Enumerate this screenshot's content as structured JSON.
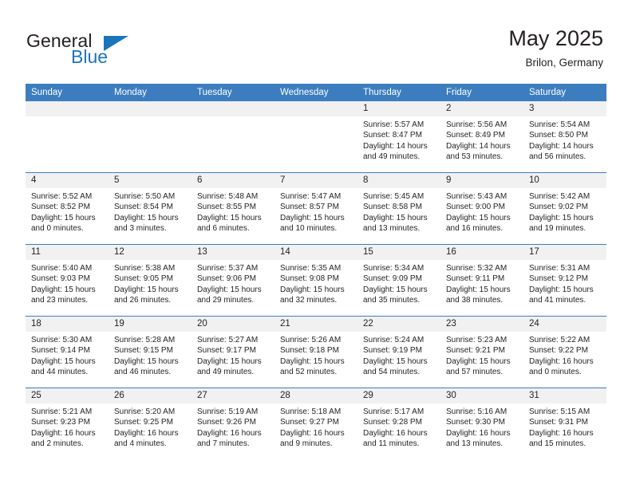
{
  "brand": {
    "name_part1": "General",
    "name_part2": "Blue",
    "color_dark": "#231f20",
    "color_blue": "#1b75bb"
  },
  "header": {
    "title": "May 2025",
    "subtitle": "Brilon, Germany"
  },
  "theme": {
    "header_row_bg": "#3c7dbf",
    "daynum_bg": "#f1f1f1",
    "row_divider": "#3c7dbf",
    "text": "#231f20"
  },
  "weekdays": [
    "Sunday",
    "Monday",
    "Tuesday",
    "Wednesday",
    "Thursday",
    "Friday",
    "Saturday"
  ],
  "labels": {
    "sunrise": "Sunrise:",
    "sunset": "Sunset:",
    "daylight": "Daylight:"
  },
  "weeks": [
    [
      {
        "day": "",
        "blank": true
      },
      {
        "day": "",
        "blank": true
      },
      {
        "day": "",
        "blank": true
      },
      {
        "day": "",
        "blank": true
      },
      {
        "day": "1",
        "sunrise": "Sunrise: 5:57 AM",
        "sunset": "Sunset: 8:47 PM",
        "daylight1": "Daylight: 14 hours",
        "daylight2": "and 49 minutes."
      },
      {
        "day": "2",
        "sunrise": "Sunrise: 5:56 AM",
        "sunset": "Sunset: 8:49 PM",
        "daylight1": "Daylight: 14 hours",
        "daylight2": "and 53 minutes."
      },
      {
        "day": "3",
        "sunrise": "Sunrise: 5:54 AM",
        "sunset": "Sunset: 8:50 PM",
        "daylight1": "Daylight: 14 hours",
        "daylight2": "and 56 minutes."
      }
    ],
    [
      {
        "day": "4",
        "sunrise": "Sunrise: 5:52 AM",
        "sunset": "Sunset: 8:52 PM",
        "daylight1": "Daylight: 15 hours",
        "daylight2": "and 0 minutes."
      },
      {
        "day": "5",
        "sunrise": "Sunrise: 5:50 AM",
        "sunset": "Sunset: 8:54 PM",
        "daylight1": "Daylight: 15 hours",
        "daylight2": "and 3 minutes."
      },
      {
        "day": "6",
        "sunrise": "Sunrise: 5:48 AM",
        "sunset": "Sunset: 8:55 PM",
        "daylight1": "Daylight: 15 hours",
        "daylight2": "and 6 minutes."
      },
      {
        "day": "7",
        "sunrise": "Sunrise: 5:47 AM",
        "sunset": "Sunset: 8:57 PM",
        "daylight1": "Daylight: 15 hours",
        "daylight2": "and 10 minutes."
      },
      {
        "day": "8",
        "sunrise": "Sunrise: 5:45 AM",
        "sunset": "Sunset: 8:58 PM",
        "daylight1": "Daylight: 15 hours",
        "daylight2": "and 13 minutes."
      },
      {
        "day": "9",
        "sunrise": "Sunrise: 5:43 AM",
        "sunset": "Sunset: 9:00 PM",
        "daylight1": "Daylight: 15 hours",
        "daylight2": "and 16 minutes."
      },
      {
        "day": "10",
        "sunrise": "Sunrise: 5:42 AM",
        "sunset": "Sunset: 9:02 PM",
        "daylight1": "Daylight: 15 hours",
        "daylight2": "and 19 minutes."
      }
    ],
    [
      {
        "day": "11",
        "sunrise": "Sunrise: 5:40 AM",
        "sunset": "Sunset: 9:03 PM",
        "daylight1": "Daylight: 15 hours",
        "daylight2": "and 23 minutes."
      },
      {
        "day": "12",
        "sunrise": "Sunrise: 5:38 AM",
        "sunset": "Sunset: 9:05 PM",
        "daylight1": "Daylight: 15 hours",
        "daylight2": "and 26 minutes."
      },
      {
        "day": "13",
        "sunrise": "Sunrise: 5:37 AM",
        "sunset": "Sunset: 9:06 PM",
        "daylight1": "Daylight: 15 hours",
        "daylight2": "and 29 minutes."
      },
      {
        "day": "14",
        "sunrise": "Sunrise: 5:35 AM",
        "sunset": "Sunset: 9:08 PM",
        "daylight1": "Daylight: 15 hours",
        "daylight2": "and 32 minutes."
      },
      {
        "day": "15",
        "sunrise": "Sunrise: 5:34 AM",
        "sunset": "Sunset: 9:09 PM",
        "daylight1": "Daylight: 15 hours",
        "daylight2": "and 35 minutes."
      },
      {
        "day": "16",
        "sunrise": "Sunrise: 5:32 AM",
        "sunset": "Sunset: 9:11 PM",
        "daylight1": "Daylight: 15 hours",
        "daylight2": "and 38 minutes."
      },
      {
        "day": "17",
        "sunrise": "Sunrise: 5:31 AM",
        "sunset": "Sunset: 9:12 PM",
        "daylight1": "Daylight: 15 hours",
        "daylight2": "and 41 minutes."
      }
    ],
    [
      {
        "day": "18",
        "sunrise": "Sunrise: 5:30 AM",
        "sunset": "Sunset: 9:14 PM",
        "daylight1": "Daylight: 15 hours",
        "daylight2": "and 44 minutes."
      },
      {
        "day": "19",
        "sunrise": "Sunrise: 5:28 AM",
        "sunset": "Sunset: 9:15 PM",
        "daylight1": "Daylight: 15 hours",
        "daylight2": "and 46 minutes."
      },
      {
        "day": "20",
        "sunrise": "Sunrise: 5:27 AM",
        "sunset": "Sunset: 9:17 PM",
        "daylight1": "Daylight: 15 hours",
        "daylight2": "and 49 minutes."
      },
      {
        "day": "21",
        "sunrise": "Sunrise: 5:26 AM",
        "sunset": "Sunset: 9:18 PM",
        "daylight1": "Daylight: 15 hours",
        "daylight2": "and 52 minutes."
      },
      {
        "day": "22",
        "sunrise": "Sunrise: 5:24 AM",
        "sunset": "Sunset: 9:19 PM",
        "daylight1": "Daylight: 15 hours",
        "daylight2": "and 54 minutes."
      },
      {
        "day": "23",
        "sunrise": "Sunrise: 5:23 AM",
        "sunset": "Sunset: 9:21 PM",
        "daylight1": "Daylight: 15 hours",
        "daylight2": "and 57 minutes."
      },
      {
        "day": "24",
        "sunrise": "Sunrise: 5:22 AM",
        "sunset": "Sunset: 9:22 PM",
        "daylight1": "Daylight: 16 hours",
        "daylight2": "and 0 minutes."
      }
    ],
    [
      {
        "day": "25",
        "sunrise": "Sunrise: 5:21 AM",
        "sunset": "Sunset: 9:23 PM",
        "daylight1": "Daylight: 16 hours",
        "daylight2": "and 2 minutes."
      },
      {
        "day": "26",
        "sunrise": "Sunrise: 5:20 AM",
        "sunset": "Sunset: 9:25 PM",
        "daylight1": "Daylight: 16 hours",
        "daylight2": "and 4 minutes."
      },
      {
        "day": "27",
        "sunrise": "Sunrise: 5:19 AM",
        "sunset": "Sunset: 9:26 PM",
        "daylight1": "Daylight: 16 hours",
        "daylight2": "and 7 minutes."
      },
      {
        "day": "28",
        "sunrise": "Sunrise: 5:18 AM",
        "sunset": "Sunset: 9:27 PM",
        "daylight1": "Daylight: 16 hours",
        "daylight2": "and 9 minutes."
      },
      {
        "day": "29",
        "sunrise": "Sunrise: 5:17 AM",
        "sunset": "Sunset: 9:28 PM",
        "daylight1": "Daylight: 16 hours",
        "daylight2": "and 11 minutes."
      },
      {
        "day": "30",
        "sunrise": "Sunrise: 5:16 AM",
        "sunset": "Sunset: 9:30 PM",
        "daylight1": "Daylight: 16 hours",
        "daylight2": "and 13 minutes."
      },
      {
        "day": "31",
        "sunrise": "Sunrise: 5:15 AM",
        "sunset": "Sunset: 9:31 PM",
        "daylight1": "Daylight: 16 hours",
        "daylight2": "and 15 minutes."
      }
    ]
  ]
}
